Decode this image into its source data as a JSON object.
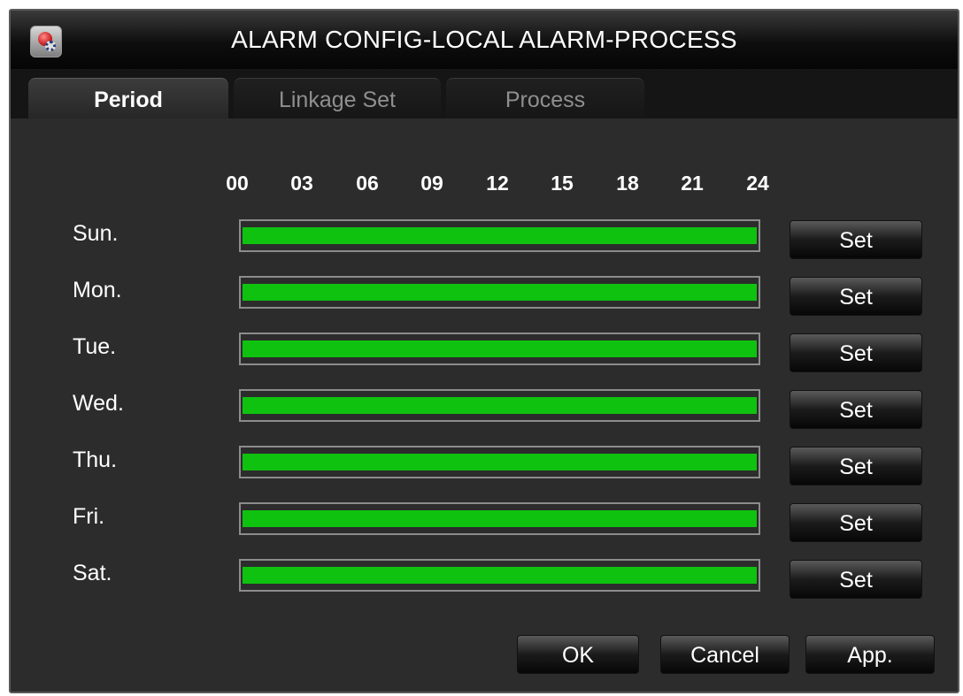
{
  "window": {
    "title": "ALARM CONFIG-LOCAL ALARM-PROCESS"
  },
  "tabs": [
    {
      "label": "Period",
      "active": true
    },
    {
      "label": "Linkage Set",
      "active": false
    },
    {
      "label": "Process",
      "active": false
    }
  ],
  "timeline": {
    "ticks": [
      "00",
      "03",
      "06",
      "09",
      "12",
      "15",
      "18",
      "21",
      "24"
    ]
  },
  "schedule": [
    {
      "day": "Sun.",
      "coverage": 1.0,
      "button": "Set"
    },
    {
      "day": "Mon.",
      "coverage": 1.0,
      "button": "Set"
    },
    {
      "day": "Tue.",
      "coverage": 1.0,
      "button": "Set"
    },
    {
      "day": "Wed.",
      "coverage": 1.0,
      "button": "Set"
    },
    {
      "day": "Thu.",
      "coverage": 1.0,
      "button": "Set"
    },
    {
      "day": "Fri.",
      "coverage": 1.0,
      "button": "Set"
    },
    {
      "day": "Sat.",
      "coverage": 1.0,
      "button": "Set"
    }
  ],
  "footer": {
    "ok": "OK",
    "cancel": "Cancel",
    "apply": "App."
  },
  "colors": {
    "schedule_fill": "#0fc20f",
    "background": "#2c2c2c",
    "text": "#ffffff"
  },
  "icons": {
    "app": "alarm-config-icon"
  }
}
